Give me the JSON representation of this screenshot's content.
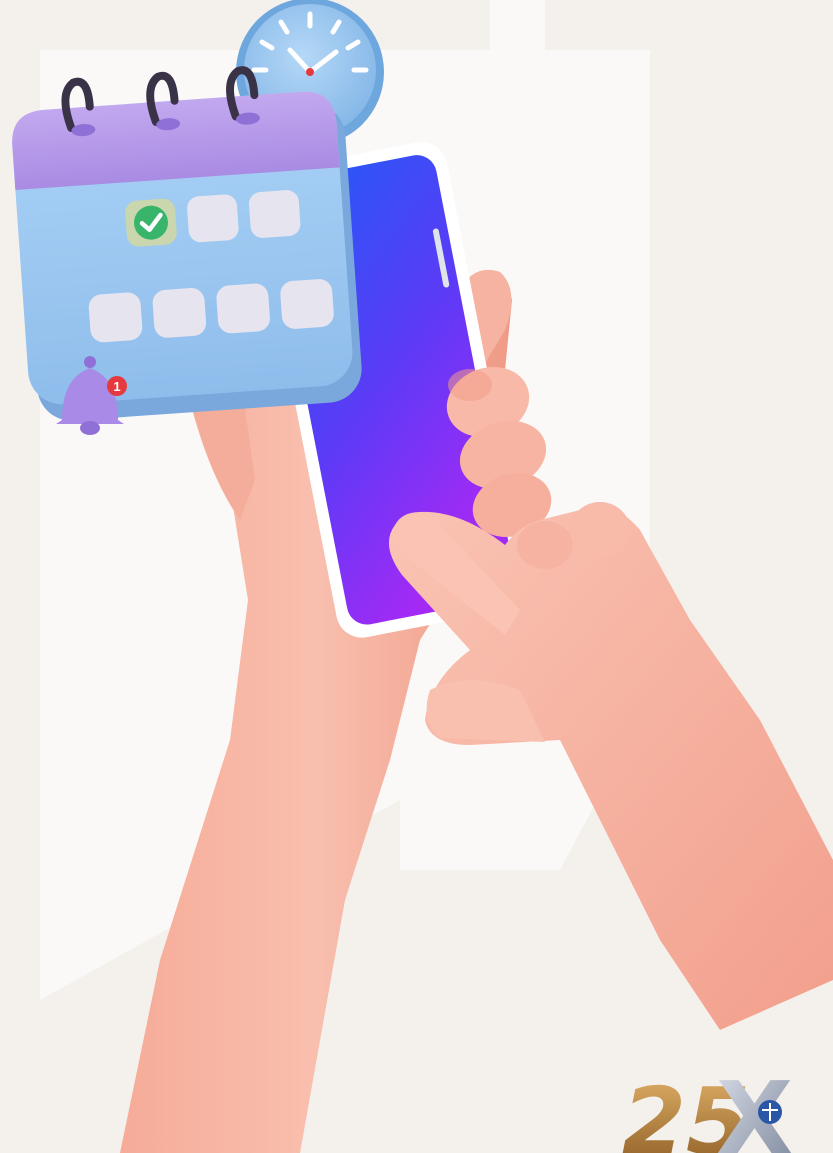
{
  "notification": {
    "badge_count": "1"
  },
  "logo": {
    "text_numeral": "25",
    "text_letter": "X"
  },
  "calendar": {
    "rows": [
      [
        {
          "state": "checked"
        },
        {
          "state": "empty"
        },
        {
          "state": "empty"
        }
      ],
      [
        {
          "state": "empty"
        },
        {
          "state": "empty"
        },
        {
          "state": "empty"
        },
        {
          "state": "empty"
        }
      ]
    ]
  },
  "icons": {
    "clock": "clock-icon",
    "calendar": "calendar-icon",
    "bell": "bell-icon",
    "check": "check-icon",
    "phone": "smartphone",
    "logo": "25x-logo"
  },
  "colors": {
    "background": "#f4f1ed",
    "backdrop_shape": "#fbfaf8",
    "clock_face": "#8fc0ee",
    "calendar_top": "#b69ae8",
    "calendar_body": "#9fc9f2",
    "calendar_cell": "#e6e4ee",
    "check_green": "#38b56a",
    "bell": "#a98ae6",
    "badge_red": "#e5393d",
    "phone_gradient_top": "#1e5ef7",
    "phone_gradient_bottom": "#a32af5",
    "skin": "#f7b6a4",
    "skin_shadow": "#ee9a87",
    "logo_gold": "#c58a3a",
    "logo_silver": "#9aa5b8",
    "logo_blue": "#2a56a8"
  }
}
